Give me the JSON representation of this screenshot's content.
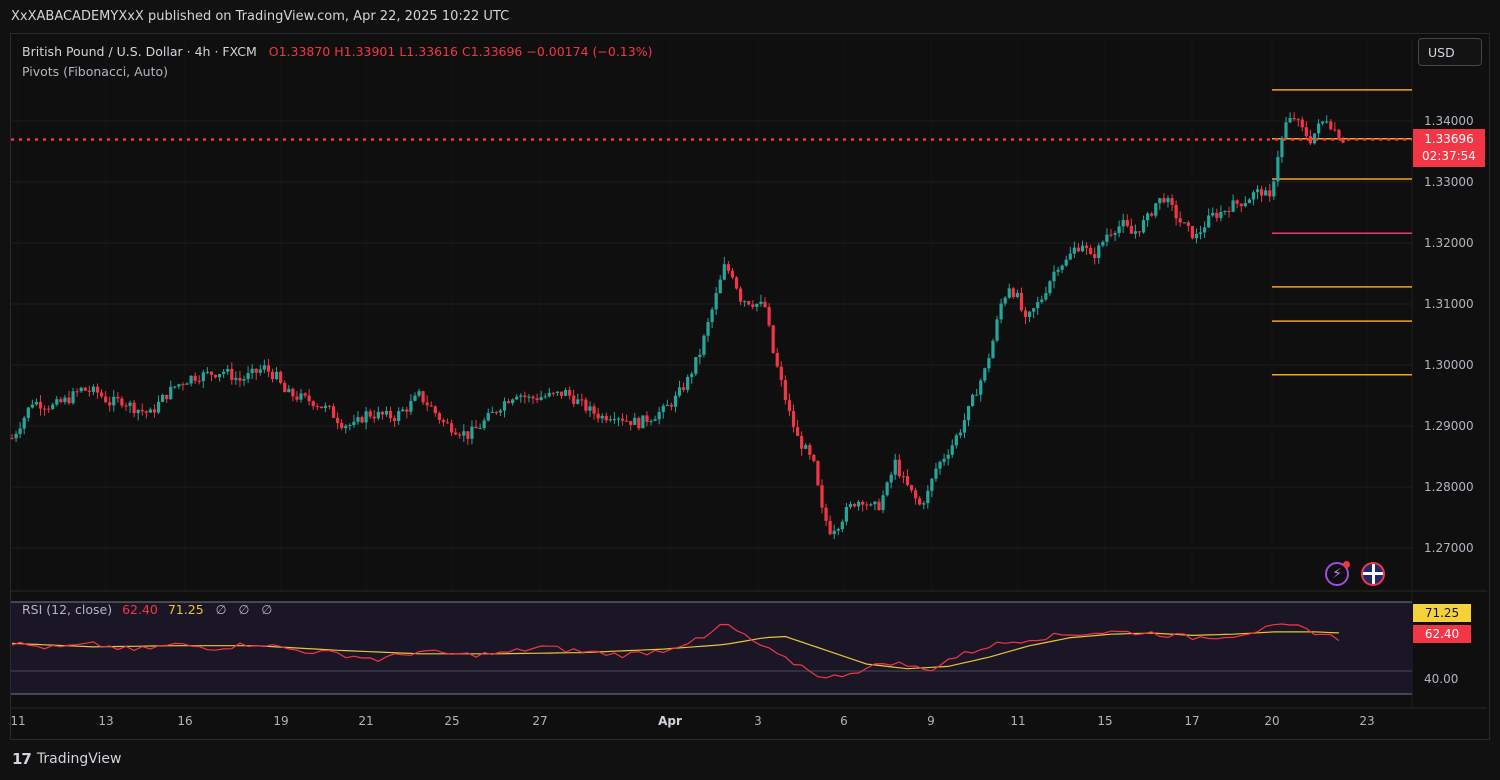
{
  "publish_info": "XxXABACADEMYXxX published on TradingView.com, Apr 22, 2025 10:22 UTC",
  "legend": {
    "symbol": "British Pound / U.S. Dollar · 4h · FXCM",
    "open": "O1.33870",
    "high": "H1.33901",
    "low": "L1.33616",
    "close": "C1.33696",
    "change": "−0.00174 (−0.13%)",
    "indicator": "Pivots (Fibonacci, Auto)"
  },
  "currency_button": "USD",
  "price_tag": {
    "price": "1.33696",
    "countdown": "02:37:54"
  },
  "rsi": {
    "label": "RSI (12, close)",
    "value": "62.40",
    "ma_value": "71.25",
    "extra": [
      "∅",
      "∅",
      "∅"
    ],
    "tag_ma": "71.25",
    "tag_value": "62.40",
    "level_label": "40.00"
  },
  "branding": {
    "logo": "17",
    "name": "TradingView"
  },
  "colors": {
    "up": "#26a69a",
    "down": "#f23645",
    "pivot": "#f7a21b",
    "pivot_mid": "#e83e6c",
    "rsi_line": "#f23645",
    "rsi_ma": "#e8c33b"
  },
  "icons": [
    "lightning-icon",
    "uk-flag-icon"
  ],
  "chart_data": {
    "type": "candlestick",
    "symbol": "GBPUSD",
    "timeframe": "4h",
    "y_axis": {
      "ticks": [
        1.27,
        1.28,
        1.29,
        1.3,
        1.31,
        1.32,
        1.33,
        1.34
      ],
      "tick_labels": [
        "1.27000",
        "1.28000",
        "1.29000",
        "1.30000",
        "1.31000",
        "1.32000",
        "1.33000",
        "1.34000"
      ],
      "range": [
        1.2645,
        1.351
      ]
    },
    "x_axis": {
      "labels": [
        "11",
        "13",
        "16",
        "19",
        "21",
        "25",
        "27",
        "Apr",
        "3",
        "6",
        "9",
        "11",
        "15",
        "17",
        "20",
        "23"
      ]
    },
    "last_price": 1.33696,
    "pivot_levels": [
      1.3451,
      1.3371,
      1.3305,
      1.3216,
      1.3128,
      1.3072,
      1.2984
    ],
    "price_path": [
      [
        0,
        1.288
      ],
      [
        3,
        1.2915
      ],
      [
        5,
        1.294
      ],
      [
        10,
        1.2932
      ],
      [
        14,
        1.2945
      ],
      [
        17,
        1.296
      ],
      [
        21,
        1.2955
      ],
      [
        24,
        1.2938
      ],
      [
        27,
        1.2942
      ],
      [
        30,
        1.293
      ],
      [
        34,
        1.292
      ],
      [
        37,
        1.2945
      ],
      [
        40,
        1.2965
      ],
      [
        44,
        1.298
      ],
      [
        48,
        1.2985
      ],
      [
        52,
        1.299
      ],
      [
        56,
        1.2975
      ],
      [
        59,
        1.2985
      ],
      [
        62,
        1.2995
      ],
      [
        65,
        1.298
      ],
      [
        67,
        1.2955
      ],
      [
        70,
        1.2948
      ],
      [
        74,
        1.294
      ],
      [
        78,
        1.2925
      ],
      [
        81,
        1.2905
      ],
      [
        84,
        1.29
      ],
      [
        87,
        1.292
      ],
      [
        90,
        1.2918
      ],
      [
        94,
        1.2915
      ],
      [
        97,
        1.293
      ],
      [
        100,
        1.295
      ],
      [
        103,
        1.293
      ],
      [
        106,
        1.2905
      ],
      [
        109,
        1.2895
      ],
      [
        112,
        1.2885
      ],
      [
        115,
        1.29
      ],
      [
        118,
        1.292
      ],
      [
        121,
        1.294
      ],
      [
        124,
        1.2955
      ],
      [
        127,
        1.2945
      ],
      [
        130,
        1.2948
      ],
      [
        133,
        1.295
      ],
      [
        136,
        1.2955
      ],
      [
        139,
        1.294
      ],
      [
        142,
        1.2925
      ],
      [
        145,
        1.2915
      ],
      [
        148,
        1.292
      ],
      [
        151,
        1.291
      ],
      [
        154,
        1.2905
      ],
      [
        157,
        1.2915
      ],
      [
        160,
        1.2925
      ],
      [
        163,
        1.2945
      ],
      [
        166,
        1.2975
      ],
      [
        169,
        1.302
      ],
      [
        172,
        1.309
      ],
      [
        175,
        1.316
      ],
      [
        177,
        1.315
      ],
      [
        179,
        1.311
      ],
      [
        181,
        1.3105
      ],
      [
        183,
        1.31
      ],
      [
        185,
        1.3095
      ],
      [
        187,
        1.302
      ],
      [
        189,
        1.297
      ],
      [
        191,
        1.292
      ],
      [
        193,
        1.288
      ],
      [
        195,
        1.286
      ],
      [
        197,
        1.2835
      ],
      [
        199,
        1.276
      ],
      [
        201,
        1.273
      ],
      [
        203,
        1.274
      ],
      [
        205,
        1.276
      ],
      [
        207,
        1.2775
      ],
      [
        209,
        1.278
      ],
      [
        211,
        1.2765
      ],
      [
        213,
        1.277
      ],
      [
        215,
        1.28
      ],
      [
        217,
        1.284
      ],
      [
        219,
        1.281
      ],
      [
        221,
        1.279
      ],
      [
        223,
        1.277
      ],
      [
        225,
        1.279
      ],
      [
        227,
        1.283
      ],
      [
        229,
        1.285
      ],
      [
        231,
        1.287
      ],
      [
        233,
        1.2895
      ],
      [
        235,
        1.2925
      ],
      [
        237,
        1.296
      ],
      [
        239,
        1.299
      ],
      [
        241,
        1.304
      ],
      [
        243,
        1.31
      ],
      [
        245,
        1.313
      ],
      [
        247,
        1.311
      ],
      [
        249,
        1.307
      ],
      [
        251,
        1.309
      ],
      [
        253,
        1.311
      ],
      [
        255,
        1.314
      ],
      [
        257,
        1.3165
      ],
      [
        259,
        1.317
      ],
      [
        261,
        1.319
      ],
      [
        263,
        1.32
      ],
      [
        265,
        1.3175
      ],
      [
        267,
        1.319
      ],
      [
        269,
        1.3215
      ],
      [
        271,
        1.3225
      ],
      [
        273,
        1.323
      ],
      [
        275,
        1.3215
      ],
      [
        277,
        1.3225
      ],
      [
        279,
        1.324
      ],
      [
        281,
        1.3265
      ],
      [
        283,
        1.3275
      ],
      [
        285,
        1.3255
      ],
      [
        287,
        1.3235
      ],
      [
        289,
        1.322
      ],
      [
        291,
        1.321
      ],
      [
        293,
        1.323
      ],
      [
        295,
        1.3245
      ],
      [
        297,
        1.325
      ],
      [
        299,
        1.326
      ],
      [
        301,
        1.3265
      ],
      [
        303,
        1.327
      ],
      [
        305,
        1.328
      ],
      [
        307,
        1.3285
      ],
      [
        309,
        1.327
      ],
      [
        311,
        1.3345
      ],
      [
        313,
        1.3395
      ],
      [
        315,
        1.3405
      ],
      [
        317,
        1.3385
      ],
      [
        319,
        1.337
      ],
      [
        321,
        1.339
      ],
      [
        323,
        1.3405
      ],
      [
        325,
        1.3385
      ],
      [
        327,
        1.337
      ]
    ],
    "rsi_path": [
      [
        0,
        64
      ],
      [
        10,
        60
      ],
      [
        20,
        63
      ],
      [
        30,
        58
      ],
      [
        40,
        63
      ],
      [
        50,
        60
      ],
      [
        60,
        64
      ],
      [
        70,
        58
      ],
      [
        80,
        55
      ],
      [
        90,
        50
      ],
      [
        100,
        57
      ],
      [
        110,
        54
      ],
      [
        120,
        55
      ],
      [
        130,
        61
      ],
      [
        140,
        57
      ],
      [
        150,
        54
      ],
      [
        160,
        58
      ],
      [
        165,
        64
      ],
      [
        170,
        68
      ],
      [
        175,
        82
      ],
      [
        180,
        70
      ],
      [
        185,
        60
      ],
      [
        190,
        50
      ],
      [
        195,
        43
      ],
      [
        200,
        33
      ],
      [
        205,
        38
      ],
      [
        210,
        42
      ],
      [
        215,
        48
      ],
      [
        220,
        45
      ],
      [
        225,
        40
      ],
      [
        230,
        50
      ],
      [
        240,
        62
      ],
      [
        250,
        68
      ],
      [
        260,
        72
      ],
      [
        270,
        74
      ],
      [
        280,
        73
      ],
      [
        290,
        69
      ],
      [
        300,
        71
      ],
      [
        310,
        78
      ],
      [
        315,
        79
      ],
      [
        320,
        74
      ],
      [
        327,
        67
      ]
    ],
    "rsi_ma_path": [
      [
        0,
        64
      ],
      [
        20,
        61
      ],
      [
        40,
        62
      ],
      [
        60,
        62
      ],
      [
        80,
        58
      ],
      [
        100,
        55
      ],
      [
        120,
        55
      ],
      [
        140,
        56
      ],
      [
        160,
        59
      ],
      [
        175,
        63
      ],
      [
        185,
        69
      ],
      [
        190,
        70
      ],
      [
        200,
        58
      ],
      [
        210,
        46
      ],
      [
        220,
        42
      ],
      [
        230,
        44
      ],
      [
        240,
        52
      ],
      [
        250,
        62
      ],
      [
        260,
        69
      ],
      [
        270,
        72
      ],
      [
        280,
        73
      ],
      [
        290,
        71
      ],
      [
        300,
        72
      ],
      [
        310,
        74
      ],
      [
        320,
        74
      ],
      [
        327,
        73
      ]
    ],
    "rsi_levels": [
      70,
      40
    ]
  }
}
